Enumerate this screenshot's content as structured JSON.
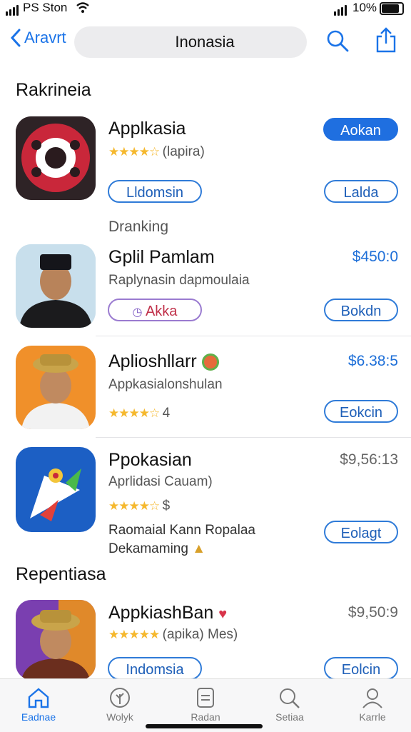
{
  "status": {
    "carrier": "PS Ston",
    "battery": "10%"
  },
  "nav": {
    "back_label": "Aravrt",
    "title": "Inonasia"
  },
  "sections": {
    "top": "Rakrineia",
    "middle": "Dranking",
    "bottom": "Repentiasa"
  },
  "apps": [
    {
      "name": "Applkasia",
      "subtitle": "",
      "rating_text": "(lapira)",
      "price": "",
      "action": "Aokan",
      "secondary": "Lldomsin",
      "tertiary": "Lalda",
      "stars": 4.5
    },
    {
      "name": "Gplil Pamlam",
      "subtitle": "Raplynasin dapmoulaia",
      "rating_text": "",
      "price": "$450:0",
      "action": "Bokdn",
      "secondary": "Akka",
      "tertiary": "",
      "stars": 0
    },
    {
      "name": "Aplioshllarr",
      "subtitle": "Appkasialonshulan",
      "rating_text": "4",
      "price": "$6.38:5",
      "action": "Eokcin",
      "secondary": "",
      "tertiary": "",
      "stars": 4.5
    },
    {
      "name": "Ppokasian",
      "subtitle": "Aprlidasi Cauam)",
      "rating_text": "$",
      "price": "$9,56:13",
      "action": "Eolagt",
      "desc1": "Raomaial Kann Ropalaa",
      "desc2": "Dekamaming",
      "stars": 4.5
    },
    {
      "name": "AppkiashBan",
      "subtitle": "",
      "rating_text": "(apika) Mes)",
      "price": "$9,50:9",
      "action": "Eolcin",
      "secondary": "Indomsia",
      "stars": 5
    }
  ],
  "tabs": [
    {
      "label": "Eadnae",
      "active": true
    },
    {
      "label": "Wolyk",
      "active": false
    },
    {
      "label": "Radan",
      "active": false
    },
    {
      "label": "Setiaa",
      "active": false
    },
    {
      "label": "Karrle",
      "active": false
    }
  ],
  "colors": {
    "accent": "#1f6fe0",
    "star": "#f5b82e"
  }
}
